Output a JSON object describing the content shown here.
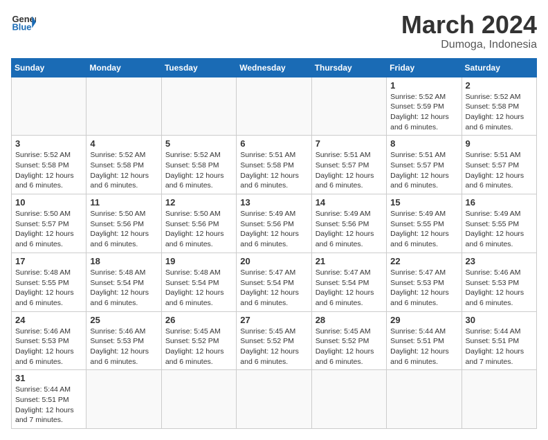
{
  "header": {
    "logo_general": "General",
    "logo_blue": "Blue",
    "month_title": "March 2024",
    "location": "Dumoga, Indonesia"
  },
  "weekdays": [
    "Sunday",
    "Monday",
    "Tuesday",
    "Wednesday",
    "Thursday",
    "Friday",
    "Saturday"
  ],
  "weeks": [
    [
      {
        "day": "",
        "info": ""
      },
      {
        "day": "",
        "info": ""
      },
      {
        "day": "",
        "info": ""
      },
      {
        "day": "",
        "info": ""
      },
      {
        "day": "",
        "info": ""
      },
      {
        "day": "1",
        "info": "Sunrise: 5:52 AM\nSunset: 5:59 PM\nDaylight: 12 hours and 6 minutes."
      },
      {
        "day": "2",
        "info": "Sunrise: 5:52 AM\nSunset: 5:58 PM\nDaylight: 12 hours and 6 minutes."
      }
    ],
    [
      {
        "day": "3",
        "info": "Sunrise: 5:52 AM\nSunset: 5:58 PM\nDaylight: 12 hours and 6 minutes."
      },
      {
        "day": "4",
        "info": "Sunrise: 5:52 AM\nSunset: 5:58 PM\nDaylight: 12 hours and 6 minutes."
      },
      {
        "day": "5",
        "info": "Sunrise: 5:52 AM\nSunset: 5:58 PM\nDaylight: 12 hours and 6 minutes."
      },
      {
        "day": "6",
        "info": "Sunrise: 5:51 AM\nSunset: 5:58 PM\nDaylight: 12 hours and 6 minutes."
      },
      {
        "day": "7",
        "info": "Sunrise: 5:51 AM\nSunset: 5:57 PM\nDaylight: 12 hours and 6 minutes."
      },
      {
        "day": "8",
        "info": "Sunrise: 5:51 AM\nSunset: 5:57 PM\nDaylight: 12 hours and 6 minutes."
      },
      {
        "day": "9",
        "info": "Sunrise: 5:51 AM\nSunset: 5:57 PM\nDaylight: 12 hours and 6 minutes."
      }
    ],
    [
      {
        "day": "10",
        "info": "Sunrise: 5:50 AM\nSunset: 5:57 PM\nDaylight: 12 hours and 6 minutes."
      },
      {
        "day": "11",
        "info": "Sunrise: 5:50 AM\nSunset: 5:56 PM\nDaylight: 12 hours and 6 minutes."
      },
      {
        "day": "12",
        "info": "Sunrise: 5:50 AM\nSunset: 5:56 PM\nDaylight: 12 hours and 6 minutes."
      },
      {
        "day": "13",
        "info": "Sunrise: 5:49 AM\nSunset: 5:56 PM\nDaylight: 12 hours and 6 minutes."
      },
      {
        "day": "14",
        "info": "Sunrise: 5:49 AM\nSunset: 5:56 PM\nDaylight: 12 hours and 6 minutes."
      },
      {
        "day": "15",
        "info": "Sunrise: 5:49 AM\nSunset: 5:55 PM\nDaylight: 12 hours and 6 minutes."
      },
      {
        "day": "16",
        "info": "Sunrise: 5:49 AM\nSunset: 5:55 PM\nDaylight: 12 hours and 6 minutes."
      }
    ],
    [
      {
        "day": "17",
        "info": "Sunrise: 5:48 AM\nSunset: 5:55 PM\nDaylight: 12 hours and 6 minutes."
      },
      {
        "day": "18",
        "info": "Sunrise: 5:48 AM\nSunset: 5:54 PM\nDaylight: 12 hours and 6 minutes."
      },
      {
        "day": "19",
        "info": "Sunrise: 5:48 AM\nSunset: 5:54 PM\nDaylight: 12 hours and 6 minutes."
      },
      {
        "day": "20",
        "info": "Sunrise: 5:47 AM\nSunset: 5:54 PM\nDaylight: 12 hours and 6 minutes."
      },
      {
        "day": "21",
        "info": "Sunrise: 5:47 AM\nSunset: 5:54 PM\nDaylight: 12 hours and 6 minutes."
      },
      {
        "day": "22",
        "info": "Sunrise: 5:47 AM\nSunset: 5:53 PM\nDaylight: 12 hours and 6 minutes."
      },
      {
        "day": "23",
        "info": "Sunrise: 5:46 AM\nSunset: 5:53 PM\nDaylight: 12 hours and 6 minutes."
      }
    ],
    [
      {
        "day": "24",
        "info": "Sunrise: 5:46 AM\nSunset: 5:53 PM\nDaylight: 12 hours and 6 minutes."
      },
      {
        "day": "25",
        "info": "Sunrise: 5:46 AM\nSunset: 5:53 PM\nDaylight: 12 hours and 6 minutes."
      },
      {
        "day": "26",
        "info": "Sunrise: 5:45 AM\nSunset: 5:52 PM\nDaylight: 12 hours and 6 minutes."
      },
      {
        "day": "27",
        "info": "Sunrise: 5:45 AM\nSunset: 5:52 PM\nDaylight: 12 hours and 6 minutes."
      },
      {
        "day": "28",
        "info": "Sunrise: 5:45 AM\nSunset: 5:52 PM\nDaylight: 12 hours and 6 minutes."
      },
      {
        "day": "29",
        "info": "Sunrise: 5:44 AM\nSunset: 5:51 PM\nDaylight: 12 hours and 6 minutes."
      },
      {
        "day": "30",
        "info": "Sunrise: 5:44 AM\nSunset: 5:51 PM\nDaylight: 12 hours and 7 minutes."
      }
    ],
    [
      {
        "day": "31",
        "info": "Sunrise: 5:44 AM\nSunset: 5:51 PM\nDaylight: 12 hours and 7 minutes."
      },
      {
        "day": "",
        "info": ""
      },
      {
        "day": "",
        "info": ""
      },
      {
        "day": "",
        "info": ""
      },
      {
        "day": "",
        "info": ""
      },
      {
        "day": "",
        "info": ""
      },
      {
        "day": "",
        "info": ""
      }
    ]
  ]
}
